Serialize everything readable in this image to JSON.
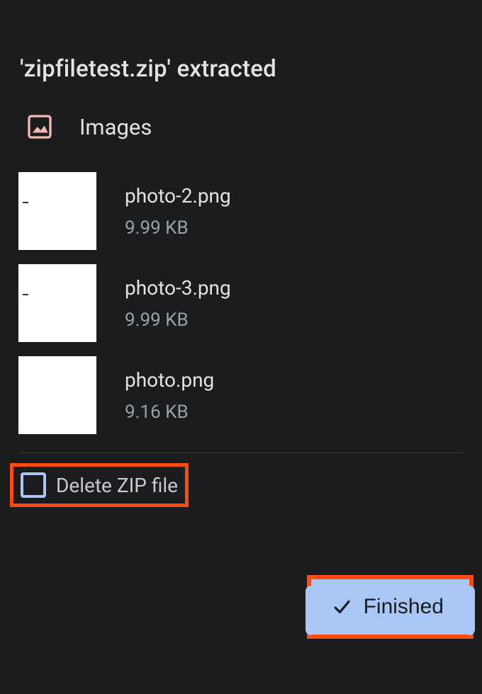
{
  "title": "'zipfiletest.zip' extracted",
  "section": {
    "label": "Images",
    "icon": "image-icon"
  },
  "files": [
    {
      "name": "photo-2.png",
      "size": "9.99 KB"
    },
    {
      "name": "photo-3.png",
      "size": "9.99 KB"
    },
    {
      "name": "photo.png",
      "size": "9.16 KB"
    }
  ],
  "delete_option": {
    "label": "Delete ZIP file",
    "checked": false
  },
  "finished_button": {
    "label": "Finished"
  },
  "colors": {
    "accent": "#a9c7f5",
    "highlight": "#ff4a12",
    "iconTint": "#f5b8b2"
  }
}
